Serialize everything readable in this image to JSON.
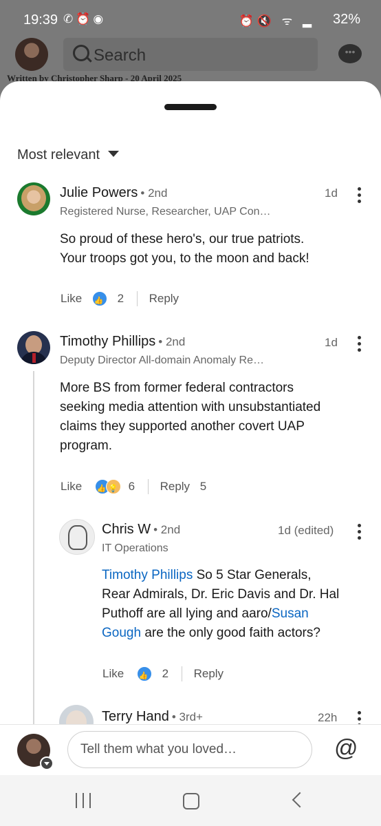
{
  "status_bar": {
    "time": "19:39",
    "left_icons": [
      "whatsapp-icon",
      "alarm-icon",
      "messenger-icon"
    ],
    "right_icons": [
      "alarm-icon",
      "mute-icon",
      "wifi-call-icon",
      "signal-icon"
    ],
    "battery": "32%"
  },
  "background_app": {
    "search_placeholder": "Search",
    "written_by": "Written by Christopher Sharp - 20 April 2025"
  },
  "sort": {
    "label": "Most relevant"
  },
  "comments": [
    {
      "author": "Julie Powers",
      "degree": "• 2nd",
      "headline": "Registered Nurse, Researcher, UAP Con…",
      "time": "1d",
      "text_line1": "So proud of these hero's, our true patriots.",
      "text_line2": "Your troops got you, to the moon and back!",
      "like_label": "Like",
      "reaction_count": "2",
      "reply_label": "Reply"
    },
    {
      "author": "Timothy Phillips",
      "degree": "• 2nd",
      "headline": "Deputy Director All-domain Anomaly Re…",
      "time": "1d",
      "text_line1": "More BS from former federal contractors",
      "text_line2": "seeking media attention with unsubstantiated",
      "text_line3": "claims they supported another covert UAP",
      "text_line4": "program.",
      "like_label": "Like",
      "reaction_count": "6",
      "reply_label": "Reply",
      "reply_count": "5"
    }
  ],
  "reply": {
    "author": "Chris W",
    "degree": "• 2nd",
    "headline": "IT Operations",
    "time": "1d (edited)",
    "mention1": "Timothy Phillips",
    "text_a": " So 5 Star Generals,",
    "text_b": "Rear Admirals, Dr. Eric Davis and Dr. Hal",
    "text_c": "Puthoff are all lying and aaro/",
    "mention2a": "Susan",
    "mention2b": "Gough",
    "text_d": " are the only good faith actors?",
    "like_label": "Like",
    "reaction_count": "2",
    "reply_label": "Reply"
  },
  "next_reply": {
    "author": "Terry Hand",
    "degree": "• 3rd+",
    "time": "22h"
  },
  "composer": {
    "placeholder": "Tell them what you loved…",
    "at_symbol": "@"
  },
  "colors": {
    "mention": "#0a66c2",
    "like_reaction": "#378fe9",
    "idea_reaction": "#f5bb5c"
  }
}
